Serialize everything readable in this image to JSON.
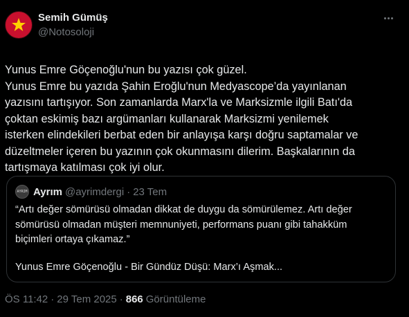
{
  "author": {
    "display_name": "Semih Gümüş",
    "handle": "@Notosoloji",
    "avatar_color": "#c8102e"
  },
  "more_icon": "more-horizontal-icon",
  "tweet_lines": [
    "Yunus Emre Göçenoğlu'nun bu yazısı çok güzel.",
    "Yunus Emre bu yazıda Şahin Eroğlu'nun Medyascope’da yayınlanan",
    "yazısını tartışıyor. Son zamanlarda Marx'la ve Marksizmle ilgili Batı'da",
    "çoktan eskimiş bazı argümanları kullanarak Marksizmi yenilemek",
    "isterken elindekileri berbat eden bir anlayışa karşı doğru saptamalar ve",
    "düzeltmeler içeren bu yazının çok okunmasını dilerim. Başkalarının da",
    "tartışmaya katılması çok iyi olur."
  ],
  "quote": {
    "avatar_text": "AYRIM",
    "display_name": "Ayrım",
    "handle": "@ayrimdergi",
    "separator": "·",
    "date": "23 Tem",
    "text_lines": [
      "“Artı değer sömürüsü olmadan dikkat de duygu da sömürülemez. Artı değer",
      "sömürüsü olmadan müşteri memnuniyeti, performans puanı gibi tahakküm",
      "biçimleri ortaya çıkamaz.”"
    ],
    "link_title": "Yunus Emre Göçenoğlu - Bir Gündüz Düşü: Marx’ı Aşmak..."
  },
  "meta": {
    "time": "ÖS 11:42",
    "separator": "·",
    "date": "29 Tem 2025",
    "views_count": "866",
    "views_label": "Görüntüleme"
  }
}
